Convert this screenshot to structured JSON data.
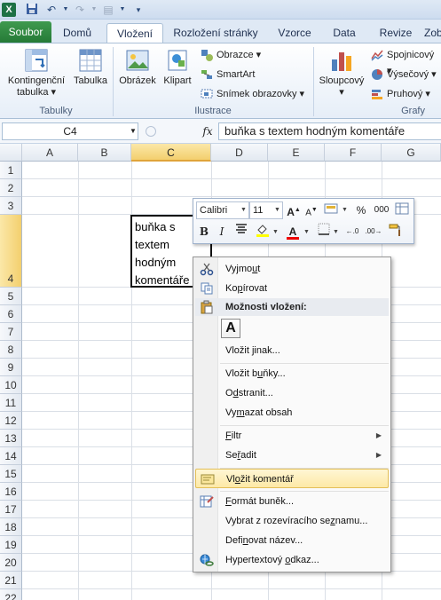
{
  "qat": {
    "undo_icon": "undo-icon",
    "redo_icon": "redo-icon"
  },
  "tabs": {
    "file": "Soubor",
    "home": "Domů",
    "insert": "Vložení",
    "layout": "Rozložení stránky",
    "formulas": "Vzorce",
    "data": "Data",
    "review": "Revize",
    "view": "Zobraz"
  },
  "ribbon": {
    "pivot_line1": "Kontingenční",
    "pivot_line2": "tabulka",
    "table": "Tabulka",
    "group_tables": "Tabulky",
    "picture": "Obrázek",
    "clipart": "Klipart",
    "shapes": "Obrazce",
    "smartart": "SmartArt",
    "screenshot": "Snímek obrazovky",
    "group_illustrations": "Ilustrace",
    "column": "Sloupcový",
    "line": "Spojnicový",
    "pie": "Výsečový",
    "bar": "Pruhový",
    "group_charts": "Grafy"
  },
  "formula_bar": {
    "name_box": "C4",
    "fx": "fx",
    "content": "buňka s textem hodným komentáře"
  },
  "grid": {
    "columns": [
      "A",
      "B",
      "C",
      "D",
      "E",
      "F",
      "G"
    ],
    "rows": [
      "1",
      "2",
      "3",
      "4",
      "5",
      "6",
      "7",
      "8",
      "9",
      "10",
      "11",
      "12",
      "13",
      "14",
      "15",
      "16",
      "17",
      "18",
      "19",
      "20",
      "21",
      "22"
    ],
    "cell_c4_lines": [
      "buňka s",
      "textem",
      "hodným",
      "komentáře"
    ]
  },
  "mini_toolbar": {
    "font": "Calibri",
    "size": "11",
    "percent": "%",
    "thousands": "000",
    "bold": "B",
    "italic": "I"
  },
  "context_menu": {
    "cut_pre": "Vyjmo",
    "cut_acc": "u",
    "cut_post": "t",
    "copy_pre": "Ko",
    "copy_acc": "p",
    "copy_post": "írovat",
    "paste_options": "Možnosti vložení:",
    "paste_a": "A",
    "paste_special_pre": "Vložit ",
    "paste_special_acc": "j",
    "paste_special_post": "inak...",
    "insert_cells_pre": "Vložit b",
    "insert_cells_acc": "u",
    "insert_cells_post": "ňky...",
    "delete_pre": "O",
    "delete_acc": "d",
    "delete_post": "stranit...",
    "clear_pre": "Vy",
    "clear_acc": "m",
    "clear_post": "azat obsah",
    "filter_pre": "",
    "filter_acc": "F",
    "filter_post": "iltr",
    "sort_pre": "Se",
    "sort_acc": "ř",
    "sort_post": "adit",
    "insert_comment_pre": "Vl",
    "insert_comment_acc": "o",
    "insert_comment_post": "žit komentář",
    "format_cells_pre": "",
    "format_cells_acc": "F",
    "format_cells_post": "ormát buněk...",
    "pick_list_pre": "Vybrat z rozevíracího se",
    "pick_list_acc": "z",
    "pick_list_post": "namu...",
    "define_name_pre": "Defi",
    "define_name_acc": "n",
    "define_name_post": "ovat název...",
    "hyperlink_pre": "Hypertextový ",
    "hyperlink_acc": "o",
    "hyperlink_post": "dkaz..."
  }
}
